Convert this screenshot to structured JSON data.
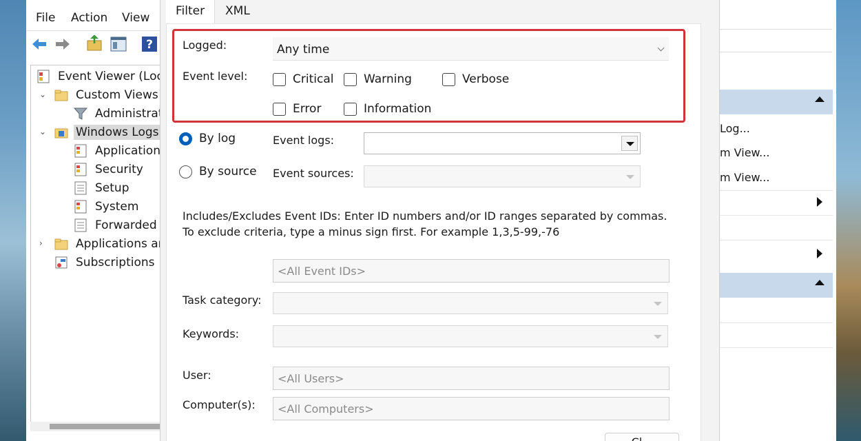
{
  "mmc": {
    "menu": [
      "File",
      "Action",
      "View"
    ],
    "tree": [
      {
        "label": "Event Viewer (Local)",
        "indent": 0
      },
      {
        "label": "Custom Views",
        "indent": 1
      },
      {
        "label": "Administrati",
        "indent": 2
      },
      {
        "label": "Windows Logs",
        "indent": 1
      },
      {
        "label": "Application",
        "indent": 2
      },
      {
        "label": "Security",
        "indent": 2
      },
      {
        "label": "Setup",
        "indent": 2
      },
      {
        "label": "System",
        "indent": 2
      },
      {
        "label": "Forwarded E",
        "indent": 2
      },
      {
        "label": "Applications and",
        "indent": 1
      },
      {
        "label": "Subscriptions",
        "indent": 1
      }
    ],
    "actions": [
      "Log...",
      "m View...",
      "m View..."
    ]
  },
  "dialog": {
    "tabs": [
      "Filter",
      "XML"
    ],
    "logged_label": "Logged:",
    "logged_value": "Any time",
    "event_level_label": "Event level:",
    "levels": [
      "Critical",
      "Warning",
      "Verbose",
      "Error",
      "Information"
    ],
    "by_log": "By log",
    "by_source": "By source",
    "event_logs_label": "Event logs:",
    "event_sources_label": "Event sources:",
    "event_logs_value": "",
    "includes_text": "Includes/Excludes Event IDs: Enter ID numbers and/or ID ranges separated by commas. To exclude criteria, type a minus sign first. For example 1,3,5-99,-76",
    "event_ids_placeholder": "<All Event IDs>",
    "task_category_label": "Task category:",
    "keywords_label": "Keywords:",
    "user_label": "User:",
    "user_placeholder": "<All Users>",
    "computer_label": "Computer(s):",
    "computer_placeholder": "<All Computers>",
    "close_label": "Cl..."
  },
  "colors": {
    "highlight": "#d13438",
    "radio_selected": "#005fb8",
    "action_header": "#c7d9ea"
  }
}
